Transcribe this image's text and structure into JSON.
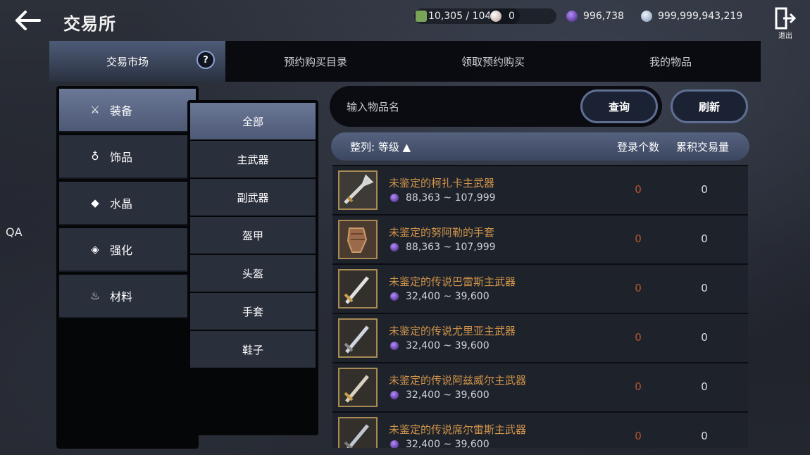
{
  "header": {
    "title": "交易所",
    "currencies": [
      {
        "icon": "energy-icon",
        "value": "10,305 / 104",
        "color": "#7aa35a"
      },
      {
        "icon": "pearl-icon",
        "value": "0",
        "color": "#d8c4c0"
      },
      {
        "icon": "dark-crystal-icon",
        "value": "996,738",
        "color": "#7a3cc8"
      },
      {
        "icon": "silver-coin-icon",
        "value": "999,999,943,219",
        "color": "#b9cde6"
      }
    ],
    "exit_label": "退出"
  },
  "side_label": "QA",
  "tabs": [
    {
      "label": "交易市场",
      "active": true
    },
    {
      "label": "预约购买目录",
      "active": false
    },
    {
      "label": "领取预约购买",
      "active": false
    },
    {
      "label": "我的物品",
      "active": false
    }
  ],
  "help_label": "?",
  "categories": [
    {
      "label": "装备",
      "icon": "crossed-swords-icon",
      "glyph": "⚔",
      "active": true
    },
    {
      "label": "饰品",
      "icon": "ring-icon",
      "glyph": "♁",
      "active": false
    },
    {
      "label": "水晶",
      "icon": "diamond-icon",
      "glyph": "◆",
      "active": false
    },
    {
      "label": "强化",
      "icon": "enhance-icon",
      "glyph": "◈",
      "active": false
    },
    {
      "label": "材料",
      "icon": "potion-icon",
      "glyph": "♨",
      "active": false
    }
  ],
  "subcategories": [
    {
      "label": "全部",
      "active": true
    },
    {
      "label": "主武器",
      "active": false
    },
    {
      "label": "副武器",
      "active": false
    },
    {
      "label": "盔甲",
      "active": false
    },
    {
      "label": "头盔",
      "active": false
    },
    {
      "label": "手套",
      "active": false
    },
    {
      "label": "鞋子",
      "active": false
    }
  ],
  "search": {
    "placeholder": "输入物品名",
    "query_label": "查询",
    "refresh_label": "刷新"
  },
  "sort": {
    "label": "整列: 等级 ▲",
    "col_registered": "登录个数",
    "col_volume": "累积交易量"
  },
  "items": [
    {
      "name": "未鉴定的柯扎卡主武器",
      "price": "88,363 ~ 107,999",
      "registered": "0",
      "volume": "0",
      "icon": "sword-icon"
    },
    {
      "name": "未鉴定的努阿勒的手套",
      "price": "88,363 ~ 107,999",
      "registered": "0",
      "volume": "0",
      "icon": "gauntlet-icon"
    },
    {
      "name": "未鉴定的传说巴雷斯主武器",
      "price": "32,400 ~ 39,600",
      "registered": "0",
      "volume": "0",
      "icon": "sword-icon"
    },
    {
      "name": "未鉴定的传说尤里亚主武器",
      "price": "32,400 ~ 39,600",
      "registered": "0",
      "volume": "0",
      "icon": "sword-icon"
    },
    {
      "name": "未鉴定的传说阿兹威尔主武器",
      "price": "32,400 ~ 39,600",
      "registered": "0",
      "volume": "0",
      "icon": "sword-icon"
    },
    {
      "name": "未鉴定的传说席尔雷斯主武器",
      "price": "32,400 ~ 39,600",
      "registered": "0",
      "volume": "0",
      "icon": "sword-icon"
    }
  ]
}
